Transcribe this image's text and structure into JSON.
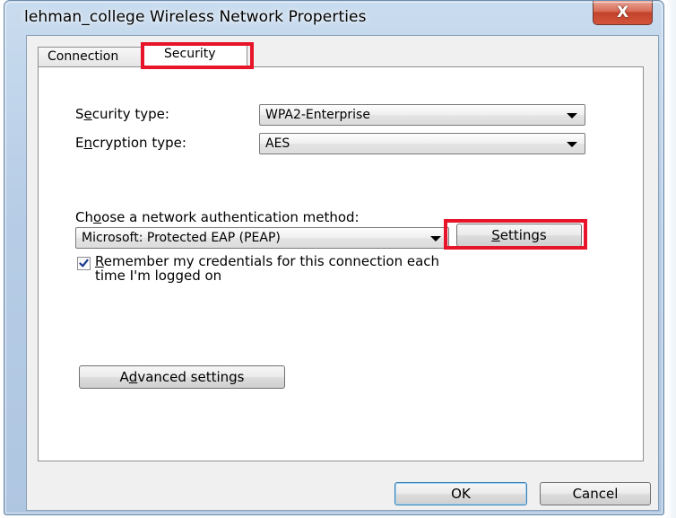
{
  "window": {
    "title": "lehman_college Wireless Network Properties",
    "close_glyph": "X"
  },
  "tabs": [
    {
      "label": "Connection",
      "selected": false
    },
    {
      "label": "Security",
      "selected": true
    }
  ],
  "security": {
    "security_type_label_pre": "S",
    "security_type_label_acc": "e",
    "security_type_label_post": "curity type:",
    "security_type_value": "WPA2-Enterprise",
    "encryption_type_label_pre": "E",
    "encryption_type_label_acc": "n",
    "encryption_type_label_post": "cryption type:",
    "encryption_type_value": "AES"
  },
  "auth": {
    "method_label_pre": "Ch",
    "method_label_acc": "o",
    "method_label_post": "ose a network authentication method:",
    "method_value": "Microsoft: Protected EAP (PEAP)",
    "settings_acc": "S",
    "settings_post": "ettings",
    "remember_checked": true,
    "remember_acc": "R",
    "remember_line1_post": "emember my credentials for this connection each",
    "remember_line2": "time I'm logged on"
  },
  "advanced": {
    "label_pre": "A",
    "label_acc": "d",
    "label_post": "vanced settings"
  },
  "footer": {
    "ok_label": "OK",
    "cancel_label": "Cancel"
  },
  "colors": {
    "highlight": "#e8142a",
    "close_button": "#c2422a"
  }
}
